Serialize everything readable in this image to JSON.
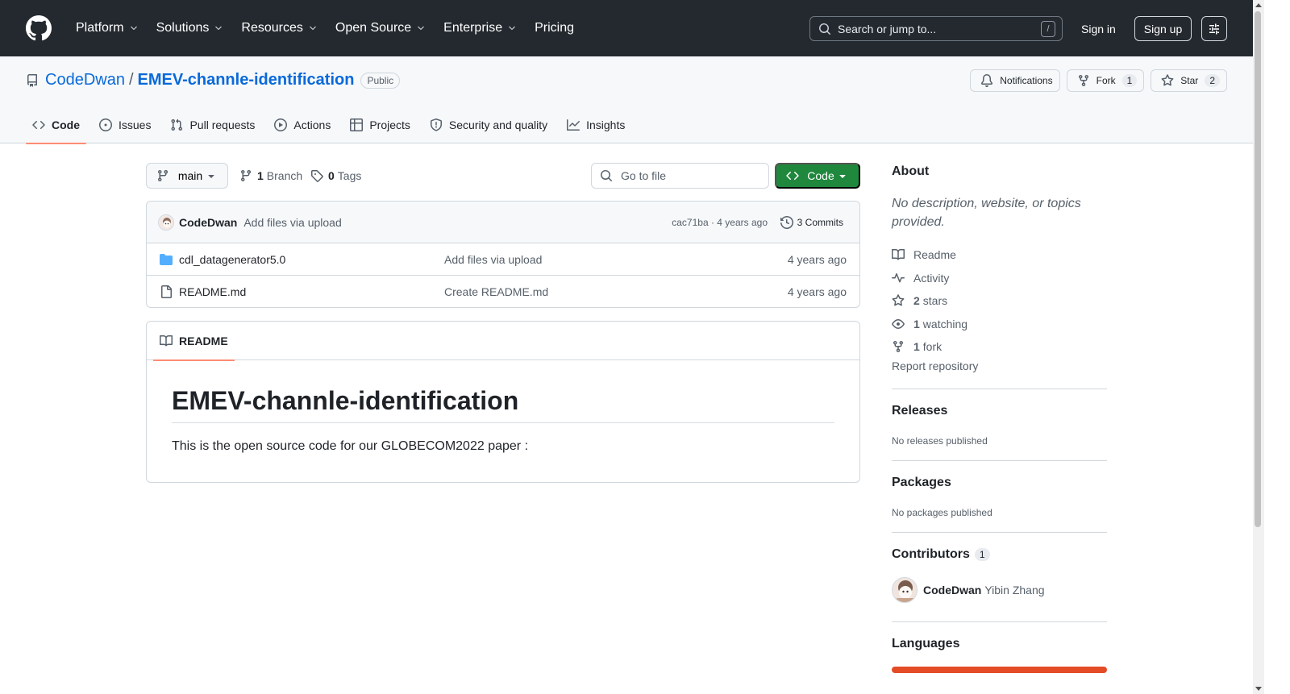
{
  "header": {
    "nav": [
      {
        "label": "Platform",
        "dropdown": true
      },
      {
        "label": "Solutions",
        "dropdown": true
      },
      {
        "label": "Resources",
        "dropdown": true
      },
      {
        "label": "Open Source",
        "dropdown": true
      },
      {
        "label": "Enterprise",
        "dropdown": true
      },
      {
        "label": "Pricing",
        "dropdown": false
      }
    ],
    "search_placeholder": "Search or jump to...",
    "search_shortcut": "/",
    "sign_in": "Sign in",
    "sign_up": "Sign up"
  },
  "repo": {
    "owner": "CodeDwan",
    "separator": "/",
    "name": "EMEV-channle-identification",
    "visibility": "Public",
    "notifications_label": "Notifications",
    "fork_label": "Fork",
    "fork_count": "1",
    "star_label": "Star",
    "star_count": "2"
  },
  "tabs": [
    {
      "label": "Code",
      "icon": "code-icon",
      "active": true
    },
    {
      "label": "Issues",
      "icon": "issue-icon",
      "active": false
    },
    {
      "label": "Pull requests",
      "icon": "pull-request-icon",
      "active": false
    },
    {
      "label": "Actions",
      "icon": "play-icon",
      "active": false
    },
    {
      "label": "Projects",
      "icon": "table-icon",
      "active": false
    },
    {
      "label": "Security and quality",
      "icon": "shield-icon",
      "active": false
    },
    {
      "label": "Insights",
      "icon": "graph-icon",
      "active": false
    }
  ],
  "toolbar": {
    "branch": "main",
    "branch_count": "1",
    "branch_label": "Branch",
    "tag_count": "0",
    "tag_label": "Tags",
    "goto_placeholder": "Go to file",
    "code_button": "Code"
  },
  "latest_commit": {
    "author": "CodeDwan",
    "message": "Add files via upload",
    "hash_and_time": "cac71ba · 4 years ago",
    "commits_label": "3 Commits"
  },
  "files": [
    {
      "name": "cdl_datagenerator5.0",
      "type": "folder",
      "message": "Add files via upload",
      "date": "4 years ago"
    },
    {
      "name": "README.md",
      "type": "file",
      "message": "Create README.md",
      "date": "4 years ago"
    }
  ],
  "readme": {
    "tab_label": "README",
    "title": "EMEV-channle-identification",
    "body": "This is the open source code for our GLOBECOM2022 paper :"
  },
  "sidebar": {
    "about_heading": "About",
    "about_description": "No description, website, or topics provided.",
    "items": [
      {
        "icon": "book-icon",
        "bold": "",
        "label": "Readme"
      },
      {
        "icon": "pulse-icon",
        "bold": "",
        "label": "Activity"
      },
      {
        "icon": "star-icon",
        "bold": "2",
        "label": "stars"
      },
      {
        "icon": "eye-icon",
        "bold": "1",
        "label": "watching"
      },
      {
        "icon": "fork-icon",
        "bold": "1",
        "label": "fork"
      }
    ],
    "report": "Report repository",
    "releases_heading": "Releases",
    "releases_sub": "No releases published",
    "packages_heading": "Packages",
    "packages_sub": "No packages published",
    "contributors_heading": "Contributors",
    "contributors_count": "1",
    "contributor_login": "CodeDwan",
    "contributor_name": "Yibin Zhang",
    "languages_heading": "Languages",
    "language_color": "#e34c26"
  },
  "colors": {
    "header_bg": "#24292f",
    "link": "#0969da",
    "green_button": "#1f883d",
    "active_tab_underline": "#fd8c73"
  }
}
